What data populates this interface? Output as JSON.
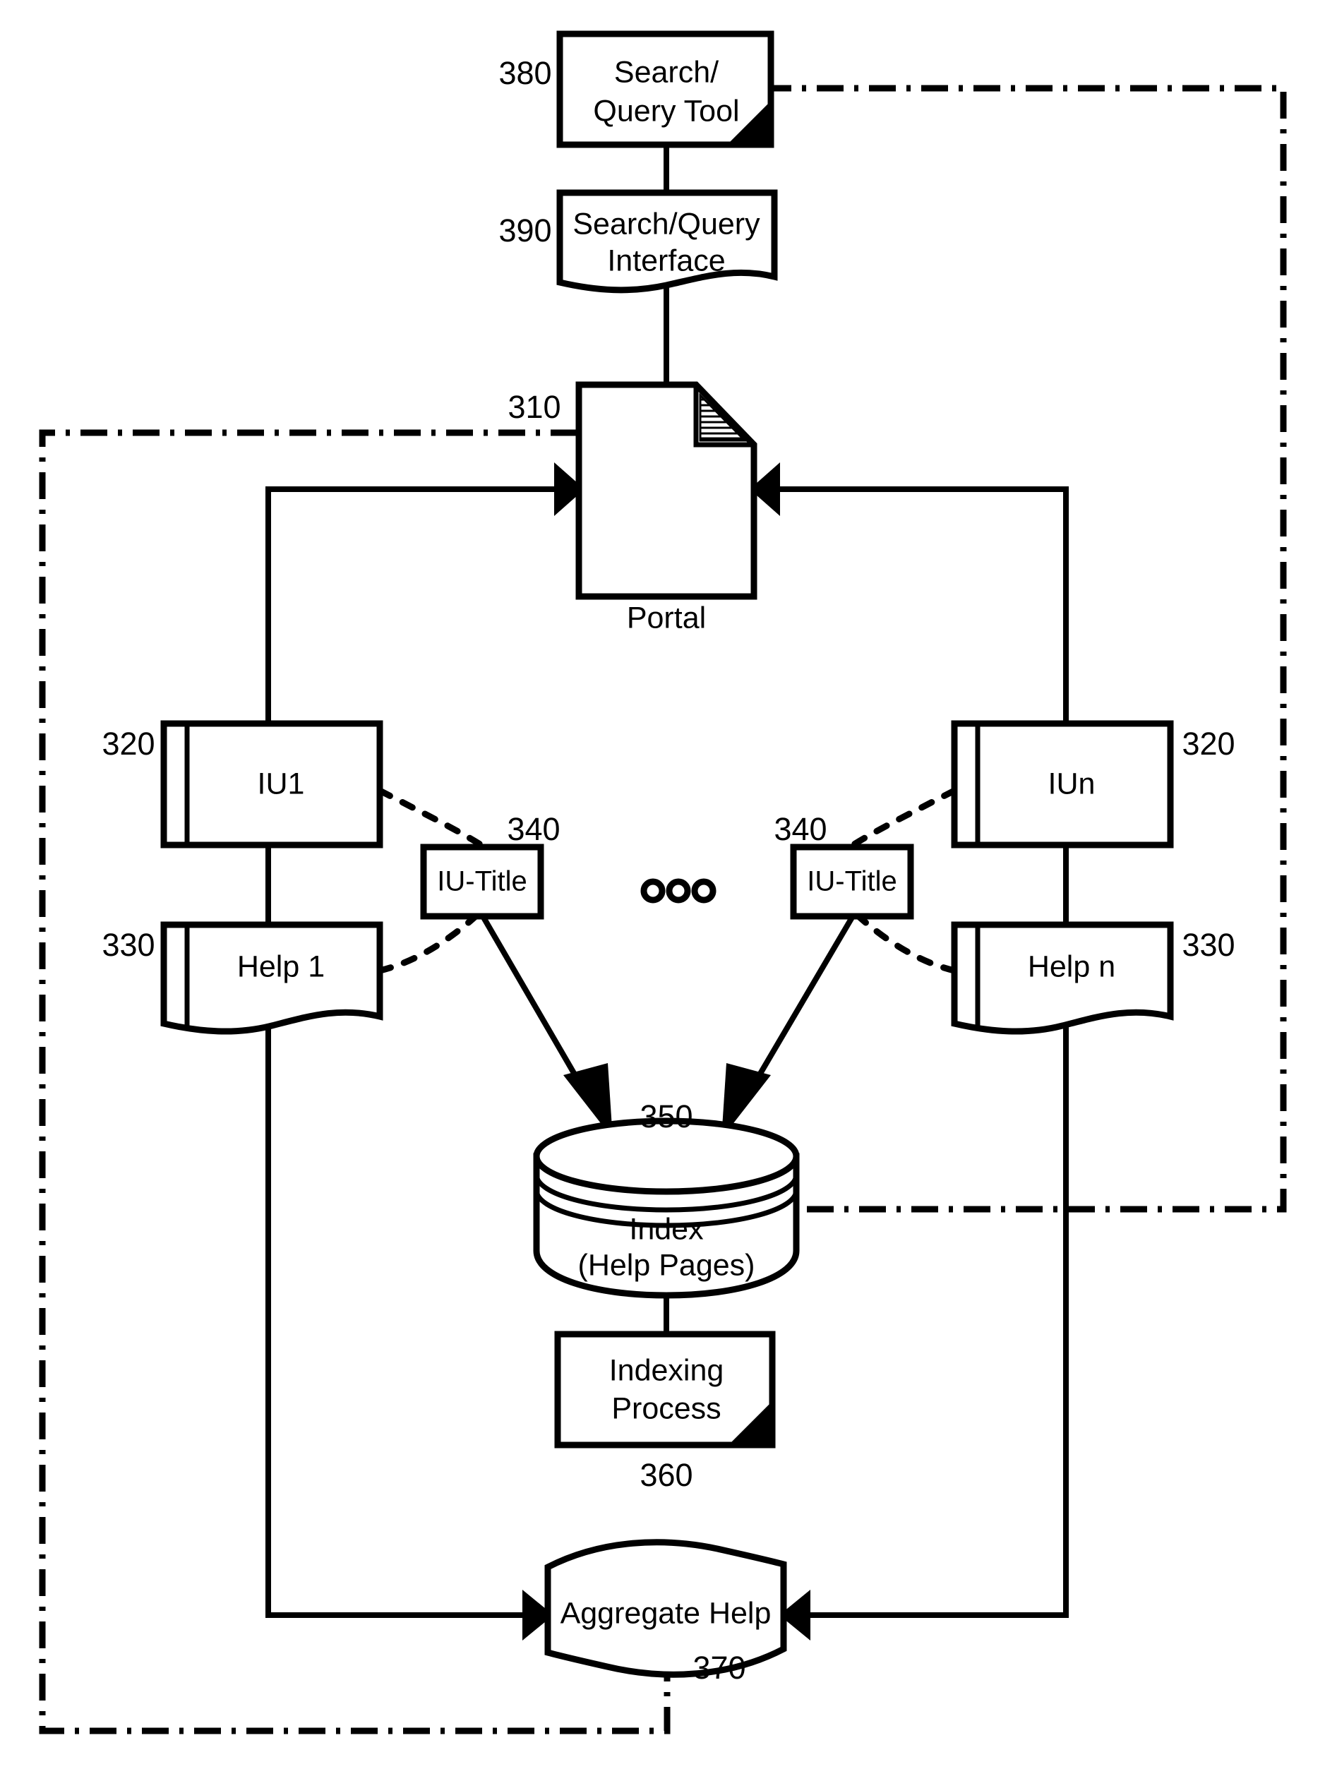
{
  "figure": {
    "kind": "patent-flow-diagram",
    "background_color": "#ffffff",
    "line_color": "#000000"
  },
  "nodes": {
    "search_query_tool": {
      "label_line1": "Search/",
      "label_line2": "Query Tool",
      "ref": "380",
      "shape": "process-box-folded-corner"
    },
    "search_query_interface": {
      "label_line1": "Search/Query",
      "label_line2": "Interface",
      "ref": "390",
      "shape": "document-wavy-bottom"
    },
    "portal": {
      "label": "Portal",
      "ref": "310",
      "shape": "document-page-dogear"
    },
    "iu1": {
      "label": "IU1",
      "ref": "320",
      "shape": "module-box"
    },
    "iun": {
      "label": "IUn",
      "ref": "320",
      "shape": "module-box"
    },
    "help1": {
      "label": "Help 1",
      "ref": "330",
      "shape": "document-wavy-bottom"
    },
    "helpn": {
      "label": "Help n",
      "ref": "330",
      "shape": "document-wavy-bottom"
    },
    "iu_title_left": {
      "label": "IU-Title",
      "ref": "340",
      "shape": "rectangle"
    },
    "iu_title_right": {
      "label": "IU-Title",
      "ref": "340",
      "shape": "rectangle"
    },
    "index": {
      "label_line1": "Index",
      "label_line2": "(Help Pages)",
      "ref": "350",
      "shape": "cylinder-disk-stack"
    },
    "indexing_process": {
      "label_line1": "Indexing",
      "label_line2": "Process",
      "ref": "360",
      "shape": "process-box-folded-corner"
    },
    "aggregate_help": {
      "label": "Aggregate Help",
      "ref": "370",
      "shape": "wavy-ribbon"
    },
    "ellipsis": {
      "label": "ooo",
      "meaning": "repeated-items-ellipsis"
    }
  }
}
